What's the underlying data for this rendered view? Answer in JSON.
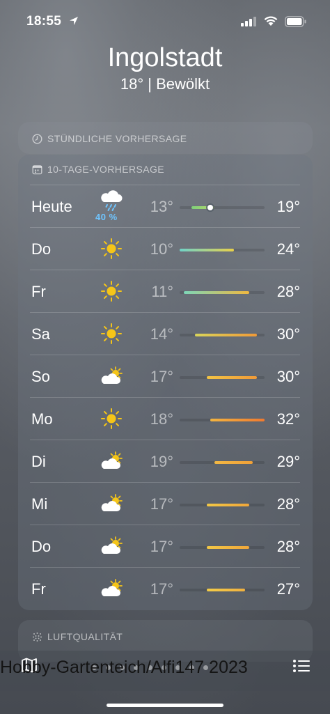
{
  "status": {
    "time": "18:55"
  },
  "location": {
    "city": "Ingolstadt",
    "summary": "18°  |  Bewölkt"
  },
  "hourly": {
    "label": "STÜNDLICHE VORHERSAGE"
  },
  "forecast": {
    "label": "10-TAGE-VORHERSAGE",
    "range": [
      10,
      32
    ],
    "days": [
      {
        "day": "Heute",
        "icon": "rain-cloud-icon",
        "pop": "40 %",
        "low": "13°",
        "high": "19°",
        "low_v": 13,
        "high_v": 19,
        "current_v": 18,
        "color_a": "#7ed07a",
        "color_b": "#b8d86a"
      },
      {
        "day": "Do",
        "icon": "sun-icon",
        "low": "10°",
        "high": "24°",
        "low_v": 10,
        "high_v": 24,
        "color_a": "#6fd3c8",
        "color_b": "#e8d04a"
      },
      {
        "day": "Fr",
        "icon": "sun-icon",
        "low": "11°",
        "high": "28°",
        "low_v": 11,
        "high_v": 28,
        "color_a": "#7dd6b8",
        "color_b": "#f0b840"
      },
      {
        "day": "Sa",
        "icon": "sun-icon",
        "low": "14°",
        "high": "30°",
        "low_v": 14,
        "high_v": 30,
        "color_a": "#d8d45a",
        "color_b": "#f09a38"
      },
      {
        "day": "So",
        "icon": "partly-cloudy-icon",
        "low": "17°",
        "high": "30°",
        "low_v": 17,
        "high_v": 30,
        "color_a": "#f2c445",
        "color_b": "#f09a38"
      },
      {
        "day": "Mo",
        "icon": "sun-icon",
        "low": "18°",
        "high": "32°",
        "low_v": 18,
        "high_v": 32,
        "color_a": "#f2b440",
        "color_b": "#f07a30"
      },
      {
        "day": "Di",
        "icon": "partly-cloudy-icon",
        "low": "19°",
        "high": "29°",
        "low_v": 19,
        "high_v": 29,
        "color_a": "#f2b844",
        "color_b": "#f0a038"
      },
      {
        "day": "Mi",
        "icon": "partly-cloudy-icon",
        "low": "17°",
        "high": "28°",
        "low_v": 17,
        "high_v": 28,
        "color_a": "#f2c846",
        "color_b": "#f0a63a"
      },
      {
        "day": "Do",
        "icon": "partly-cloudy-icon",
        "low": "17°",
        "high": "28°",
        "low_v": 17,
        "high_v": 28,
        "color_a": "#f2c846",
        "color_b": "#f0a63a"
      },
      {
        "day": "Fr",
        "icon": "partly-cloudy-icon",
        "low": "17°",
        "high": "27°",
        "low_v": 17,
        "high_v": 27,
        "color_a": "#f2cc48",
        "color_b": "#f0b040"
      }
    ]
  },
  "air": {
    "label": "LUFTQUALITÄT"
  },
  "toolbar": {
    "map": "map-icon",
    "list": "list-icon"
  },
  "watermark": "Hobby-Gartenteich/Alfi147 2023"
}
